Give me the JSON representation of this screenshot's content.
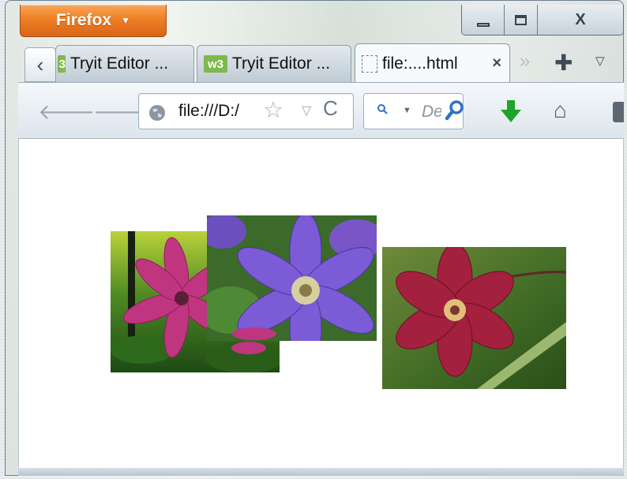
{
  "app": {
    "menu_button_label": "Firefox",
    "menu_button_caret": "▼"
  },
  "window_controls": {
    "close_glyph": "X"
  },
  "tabs": [
    {
      "label": "Tryit Editor ...",
      "icon": "w3schools-icon",
      "icon_text": "3",
      "active": false
    },
    {
      "label": "Tryit Editor ...",
      "icon": "w3schools-icon",
      "icon_text": "w3",
      "active": false
    },
    {
      "label": "file:....html",
      "icon": "blank-page-icon",
      "icon_text": "",
      "active": true,
      "close_glyph": "×"
    }
  ],
  "tab_strip": {
    "scroll_left_glyph": "‹",
    "scroll_right_glyph": "»",
    "new_tab_glyph": "✚",
    "list_all_glyph": "▽"
  },
  "toolbar": {
    "back_glyph": "🡐",
    "forward_glyph": "🡒",
    "url": "file:///D:/",
    "bookmark_glyph": "☆",
    "url_dropdown_glyph": "▽",
    "reload_glyph": "C",
    "search_placeholder": "De",
    "search_engine_caret": "▼",
    "home_glyph": "⌂"
  },
  "colors": {
    "firefox_button": "#ee7f23",
    "download_arrow": "#1fa32a",
    "search_icon": "#2f72c4"
  },
  "content": {
    "images": [
      {
        "subject": "pink clematis flower"
      },
      {
        "subject": "purple clematis flowers"
      },
      {
        "subject": "dark red clematis flower"
      }
    ]
  }
}
